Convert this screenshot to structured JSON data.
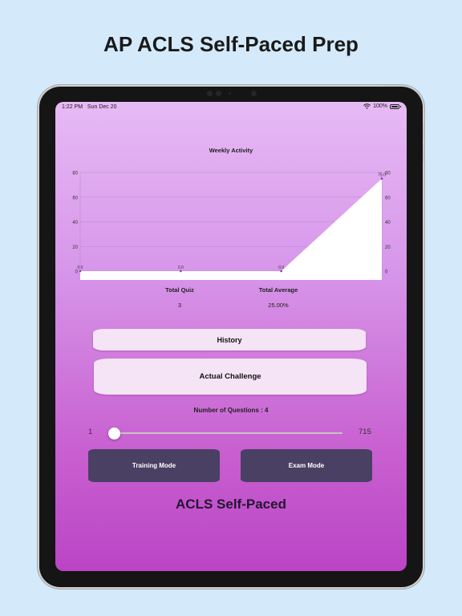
{
  "headline": "AP ACLS Self-Paced Prep",
  "status_bar": {
    "time": "1:22 PM",
    "date": "Sun Dec 20",
    "battery": "100%"
  },
  "chart_data": {
    "type": "area",
    "title": "Weekly Activity",
    "x": [
      0,
      1,
      2,
      3
    ],
    "values": [
      0.0,
      0.0,
      0.0,
      75.0
    ],
    "value_labels": [
      "0.0",
      "0.0",
      "0.0",
      "75.0"
    ],
    "ylim": [
      0,
      80
    ],
    "yticks": [
      0,
      20,
      40,
      60,
      80
    ],
    "ytick_labels": [
      "0",
      "20",
      "40",
      "60",
      "80"
    ],
    "grid": true,
    "colors": {
      "fill": "#ffffff",
      "point": "#9d2fb0",
      "grid": "#b98cc9"
    }
  },
  "stats": {
    "total_quiz_label": "Total Quiz",
    "total_quiz_value": "3",
    "total_average_label": "Total Average",
    "total_average_value": "25.00%"
  },
  "buttons": {
    "history": "History",
    "actual_challenge": "Actual Challenge",
    "training_mode": "Training Mode",
    "exam_mode": "Exam Mode"
  },
  "questions": {
    "label": "Number of Questions : 4",
    "min": "1",
    "max": "715",
    "value": 4,
    "min_value": 1,
    "max_value": 715
  },
  "brand": "ACLS Self-Paced",
  "colors": {
    "accent": "#1e88ff",
    "dark_button": "#4a4064",
    "light_button": "#f5e4f6"
  }
}
